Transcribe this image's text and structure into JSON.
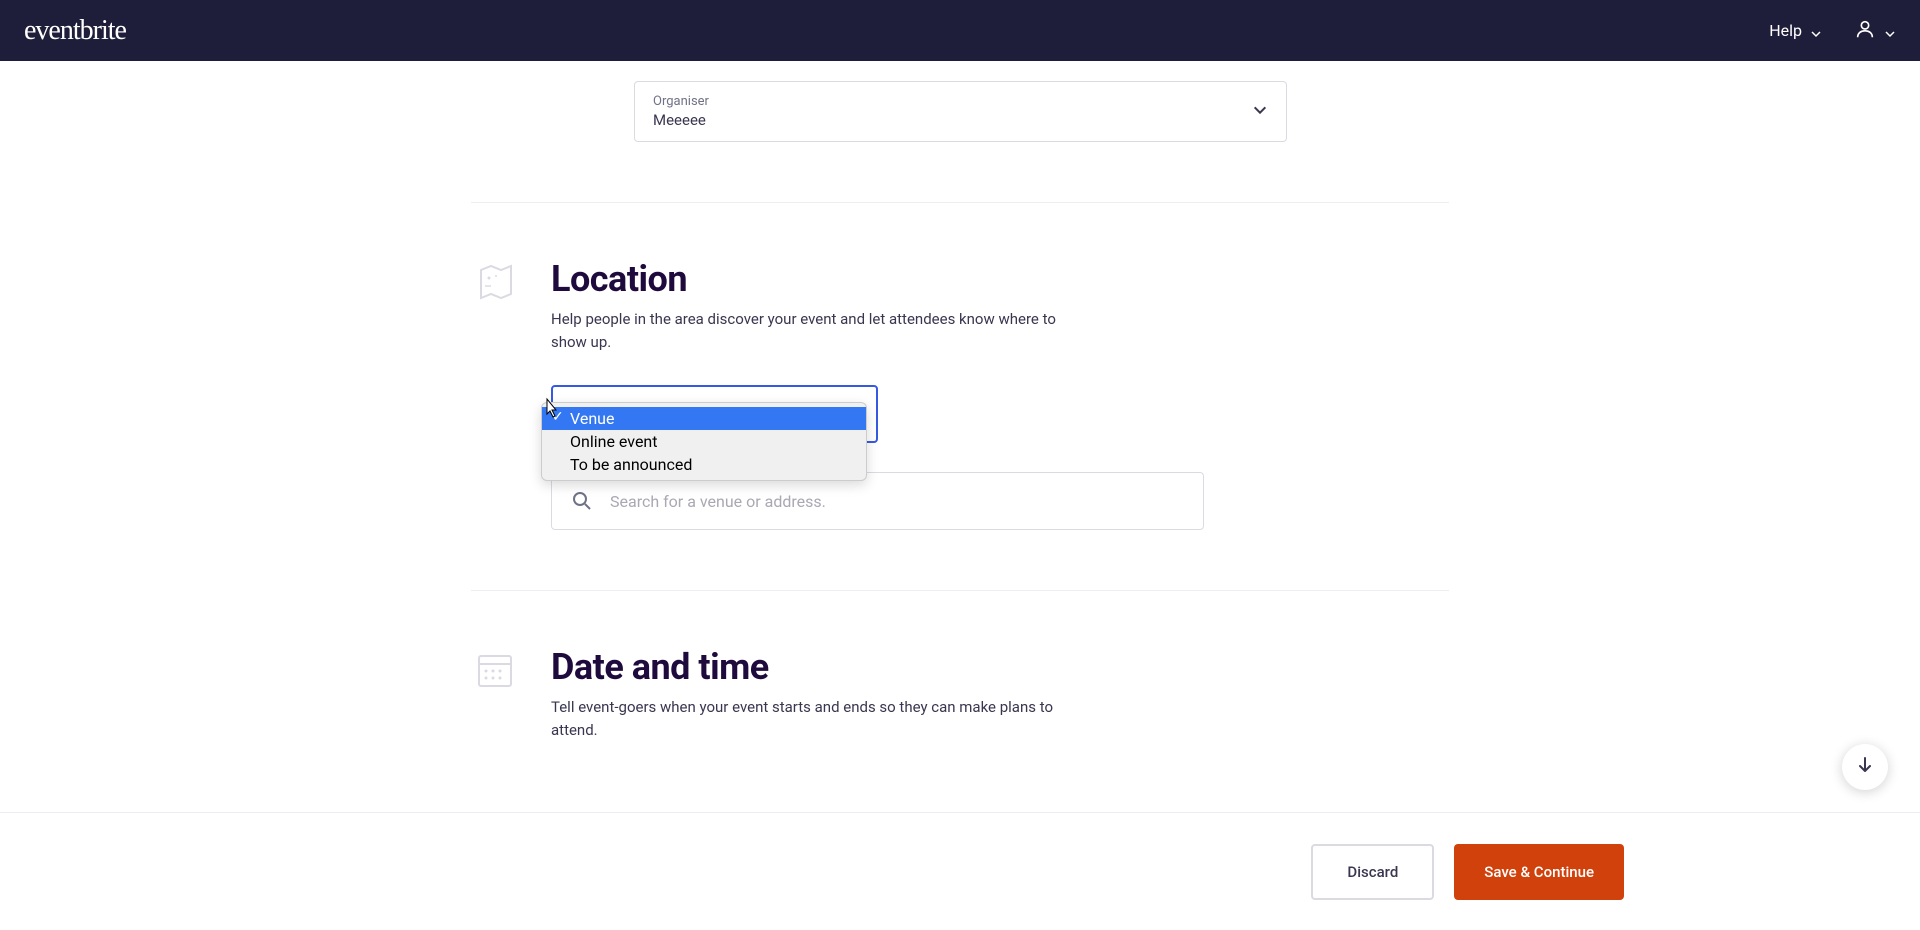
{
  "header": {
    "logo_text": "eventbrite",
    "help_label": "Help"
  },
  "organiser": {
    "label": "Organiser",
    "value": "Meeeee"
  },
  "location": {
    "title": "Location",
    "description": "Help people in the area discover your event and let attendees know where to show up.",
    "options": [
      "Venue",
      "Online event",
      "To be announced"
    ],
    "search_placeholder": "Search for a venue or address."
  },
  "datetime": {
    "title": "Date and time",
    "description": "Tell event-goers when your event starts and ends so they can make plans to attend."
  },
  "footer": {
    "discard_label": "Discard",
    "save_label": "Save & Continue"
  }
}
